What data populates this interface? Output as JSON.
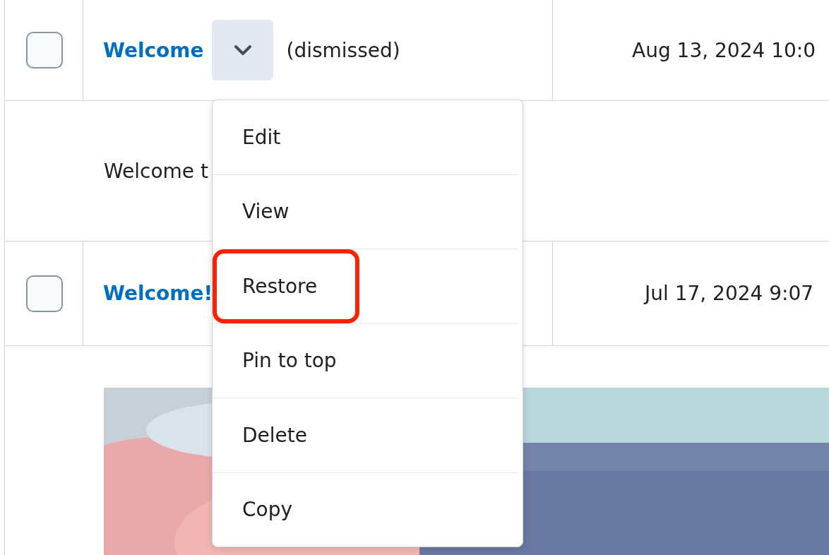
{
  "rows": [
    {
      "checked": false,
      "title": "Welcome",
      "status": "(dismissed)",
      "date": "Aug 13, 2024 10:0",
      "description": "Welcome t"
    },
    {
      "checked": false,
      "title": "Welcome!",
      "date": "Jul 17, 2024 9:07"
    }
  ],
  "menu": {
    "items": [
      {
        "label": "Edit",
        "annotated": false
      },
      {
        "label": "View",
        "annotated": false
      },
      {
        "label": "Restore",
        "annotated": true
      },
      {
        "label": "Pin to top",
        "annotated": false
      },
      {
        "label": "Delete",
        "annotated": false
      },
      {
        "label": "Copy",
        "annotated": false
      }
    ]
  }
}
